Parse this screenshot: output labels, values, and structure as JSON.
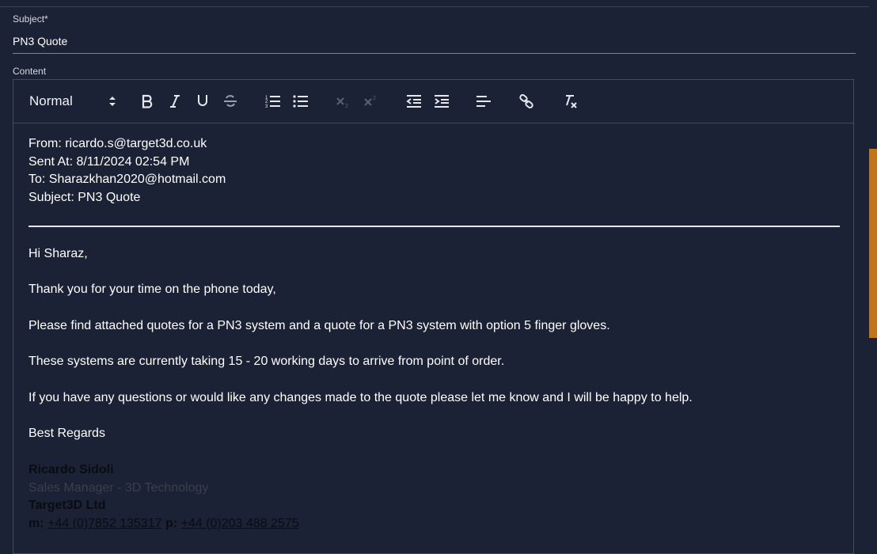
{
  "subject": {
    "label": "Subject",
    "required_mark": "*",
    "value": "PN3 Quote"
  },
  "content": {
    "label": "Content"
  },
  "toolbar": {
    "header_select": "Normal",
    "buttons": [
      "bold-icon",
      "italic-icon",
      "underline-icon",
      "strike-icon",
      "ordered-list-icon",
      "bullet-list-icon",
      "subscript-icon",
      "superscript-icon",
      "outdent-icon",
      "indent-icon",
      "align-left-icon",
      "link-icon",
      "clear-format-icon"
    ]
  },
  "email": {
    "from": "From: ricardo.s@target3d.co.uk",
    "sent_at": "Sent At: 8/11/2024 02:54 PM",
    "to": "To: Sharazkhan2020@hotmail.com",
    "subject": "Subject: PN3 Quote",
    "greeting": "Hi Sharaz,",
    "p1": "Thank you for your time on the phone today,",
    "p2": "Please find attached quotes for a PN3 system and a quote for a PN3 system with option 5 finger gloves.",
    "p3": "These systems are currently taking 15 - 20 working days to arrive from point of order.",
    "p4": "If you have any questions or would like any changes made to the quote please let me know and I will be happy to help.",
    "closing": "Best Regards"
  },
  "signature": {
    "name": "Ricardo Sidoli",
    "title": "Sales Manager - 3D Technology",
    "company": "Target3D Ltd",
    "m_label": "m:",
    "mobile": "+44 (0)7852 135317",
    "p_label": "p:",
    "phone": "+44 (0)203 488 2575"
  },
  "colors": {
    "background": "#1c2235",
    "scroll_thumb": "#c0741b",
    "text": "#ffffff"
  }
}
